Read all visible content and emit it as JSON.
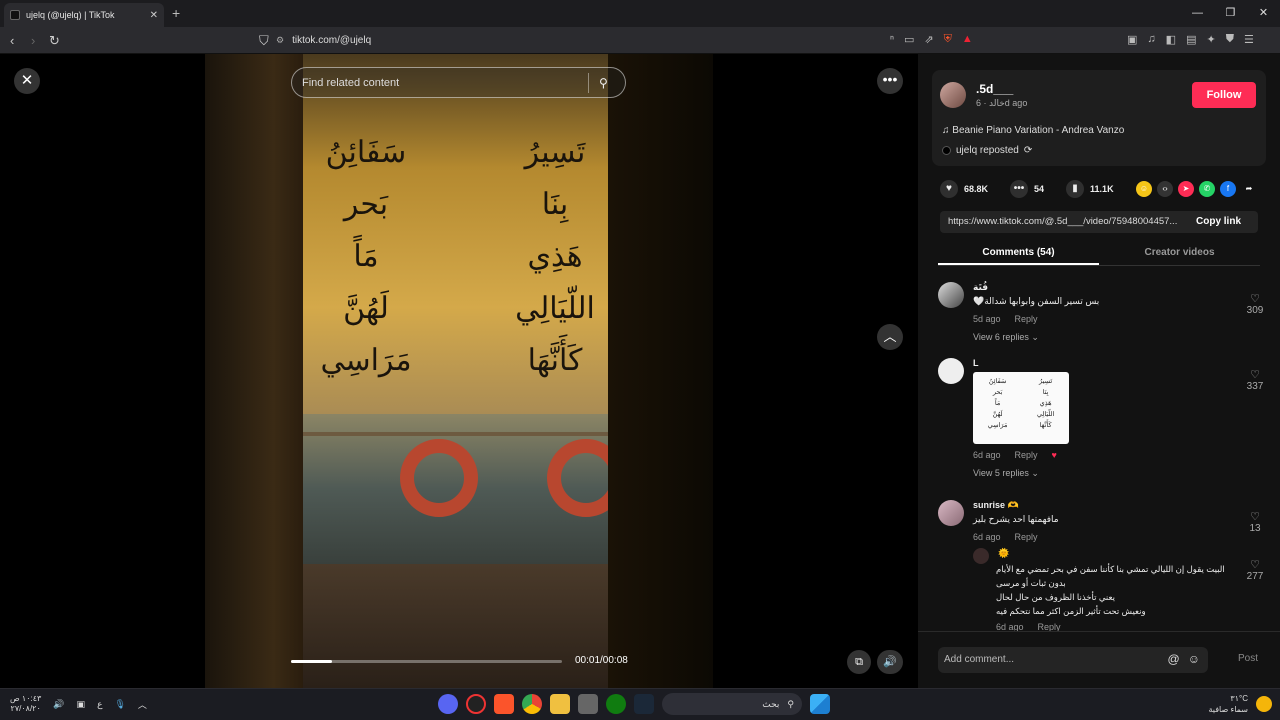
{
  "browser": {
    "tab_title": "ujelq (@ujelq) | TikTok",
    "url": "tiktok.com/@ujelq"
  },
  "video": {
    "search_placeholder": "Find related content",
    "time": "00:01/00:08",
    "progress": 0.15,
    "poem_right": [
      "تَسِيرُ",
      "بِنَا",
      "هَذِي",
      "اللّيَالِي",
      "كَأَنَّهَا"
    ],
    "poem_left": [
      "سَفَائِنُ",
      "بَحر",
      "مَاً",
      "لَهُنَّ",
      "مَرَاسِي"
    ]
  },
  "author": {
    "name": ".5d___",
    "sub": "خالد · 6d ago",
    "follow_label": "Follow",
    "music": "Beanie Piano Variation - Andrea Vanzo",
    "repost": "ujelq reposted"
  },
  "stats": {
    "likes": "68.8K",
    "comments": "54",
    "saves": "11.1K"
  },
  "share": {
    "link": "https://www.tiktok.com/@.5d___/video/75948004457...",
    "copy_label": "Copy link"
  },
  "tabs": {
    "comments": "Comments (54)",
    "creator": "Creator videos"
  },
  "comments": [
    {
      "user": "فُتَة",
      "text": "بس تسير السفن وابوابها شدالة🤍",
      "time": "5d ago",
      "reply": "Reply",
      "replies": "View 6 replies",
      "likes": "309"
    },
    {
      "user": "L",
      "time": "6d ago",
      "reply": "Reply",
      "replies": "View 5 replies",
      "likes": "337"
    },
    {
      "user": "sunrise 🫶",
      "text": "مافهمتها احد يشرح بليز",
      "time": "6d ago",
      "reply": "Reply",
      "likes": "13"
    }
  ],
  "sub_reply": {
    "lines": [
      "البيت يقول إن الليالي تمشي بنا كأننا سفن في بحر تمضي مع الأيام",
      "بدون ثبات أو مرسى",
      "يعني تأخذنا الظروف من حال لحال",
      "ونعيش تحت تأثير الزمن اكثر مما نتحكم فيه"
    ],
    "time": "6d ago",
    "reply": "Reply",
    "likes": "277"
  },
  "composer": {
    "placeholder": "Add comment...",
    "post_label": "Post"
  },
  "taskbar": {
    "time": "١٠:٤٣ ص",
    "date": "٢٧/٠٨/٢٠",
    "lang": "ع",
    "search_label": "بحث",
    "temp": "٣١°C",
    "weather": "سماء صافية"
  },
  "colors": {
    "follow": "#fe2c55",
    "panel_bg": "#121212"
  }
}
